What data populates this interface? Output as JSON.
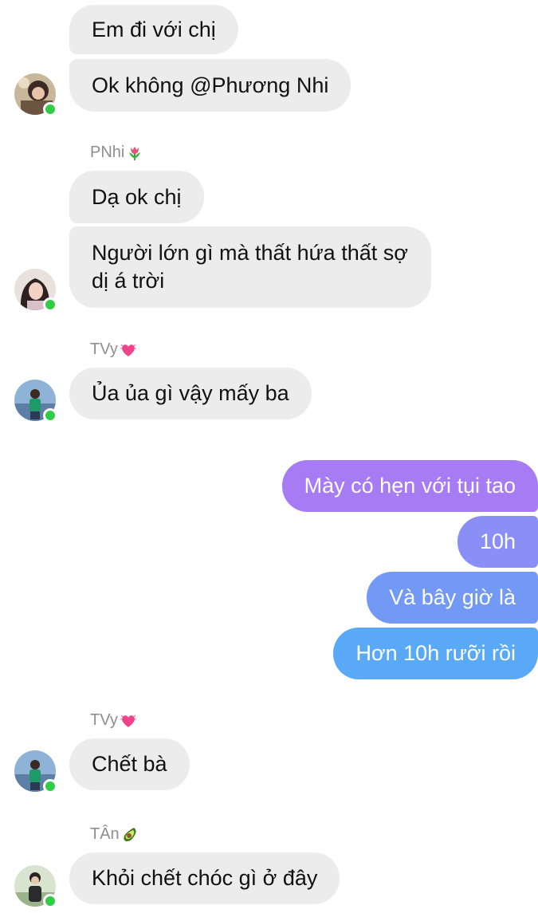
{
  "messages_in_top": [
    {
      "text": "Em đi với chị"
    },
    {
      "text": "Ok không @Phương Nhi"
    }
  ],
  "group_pnhi": {
    "sender": "PNhi",
    "sender_emoji": "tulip-icon",
    "messages": [
      {
        "text": "Dạ ok chị"
      },
      {
        "text": "Người lớn gì mà thất hứa thất sợ dị á trời"
      }
    ]
  },
  "group_tvy_1": {
    "sender": "TVy",
    "sender_emoji": "heart-icon",
    "messages": [
      {
        "text": "Ủa ủa gì vậy mấy ba"
      }
    ]
  },
  "outgoing": [
    {
      "text": "Mày có hẹn với tụi tao"
    },
    {
      "text": "10h"
    },
    {
      "text": "Và bây giờ là"
    },
    {
      "text": "Hơn 10h rưỡi rồi"
    }
  ],
  "group_tvy_2": {
    "sender": "TVy",
    "sender_emoji": "heart-icon",
    "messages": [
      {
        "text": "Chết bà"
      }
    ]
  },
  "group_tan": {
    "sender": "TÂn",
    "sender_emoji": "avocado-icon",
    "messages": [
      {
        "text": "Khỏi chết chóc gì ở đây"
      }
    ]
  },
  "colors": {
    "incoming_bubble": "#ececed",
    "outgoing_gradient_top": "#a77bf3",
    "outgoing_gradient_bottom": "#5aa9f7",
    "online_dot": "#31cc46",
    "sender_name": "#8e8e93"
  }
}
